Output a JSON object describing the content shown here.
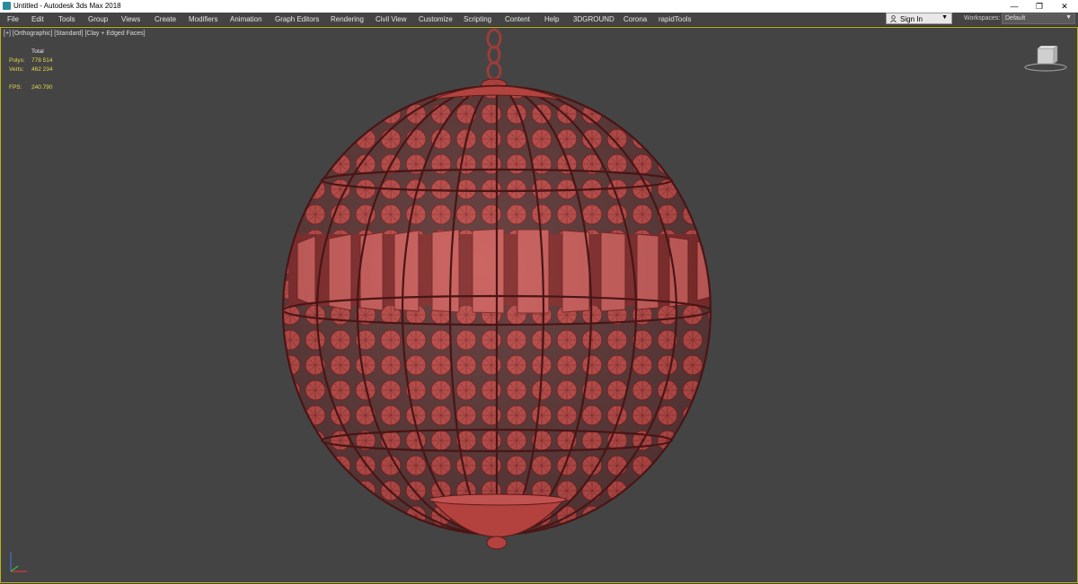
{
  "window": {
    "title": "Untitled - Autodesk 3ds Max 2018",
    "controls": {
      "minimize": "—",
      "restore": "❐",
      "close": "✕"
    }
  },
  "menu": {
    "items": [
      "File",
      "Edit",
      "Tools",
      "Group",
      "Views",
      "Create",
      "Modifiers",
      "Animation",
      "Graph Editors",
      "Rendering",
      "Civil View",
      "Customize",
      "Scripting",
      "Content",
      "Help",
      "3DGROUND",
      "Corona",
      "rapidTools"
    ]
  },
  "account": {
    "sign_in_label": "Sign In"
  },
  "workspaces": {
    "label": "Workspaces:",
    "value": "Default"
  },
  "viewport": {
    "label": "[+] [Orthographic] [Standard] [Clay + Edged Faces]",
    "stats": {
      "header": "Total",
      "polys_label": "Polys:",
      "polys_value": "778 514",
      "verts_label": "Verts:",
      "verts_value": "462 234",
      "fps_label": "FPS:",
      "fps_value": "240.790"
    }
  },
  "colors": {
    "viewport_bg": "#444444",
    "model": "#b84a48",
    "wire": "#6a1f1f",
    "active_border": "#b9b21d",
    "stat_text": "#e6d94a"
  },
  "icons": [
    "app-icon",
    "user-icon",
    "chevron-down-icon",
    "view-cube-icon",
    "axis-gizmo-icon"
  ]
}
